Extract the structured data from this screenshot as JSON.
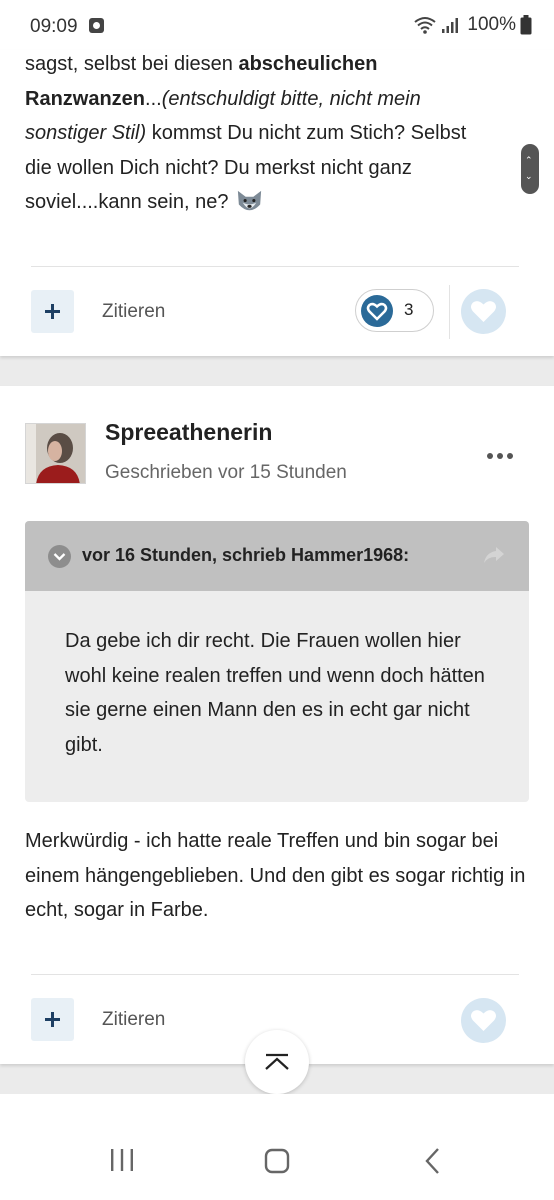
{
  "status_bar": {
    "time": "09:09",
    "battery": "100%"
  },
  "post1": {
    "text_line1_normal": "sagst, selbst bei diesen ",
    "text_line1_bold": "abscheulichen",
    "text_line2_bold": "Ranzwanzen",
    "text_line2_normal": "...",
    "text_line2_italic": "(entschuldigt bitte, nicht mein",
    "text_line3_italic": "sonstiger Stil)",
    "text_line3_normal": " kommst Du nicht zum Stich? Selbst",
    "text_line4": "die wollen Dich nicht? Du merkst nicht ganz",
    "text_line5": "soviel....kann sein, ne? ",
    "emoji": "wolf-face",
    "quote_label": "Zitieren",
    "like_count": "3"
  },
  "post2": {
    "author": "Spreeathenerin",
    "meta": "Geschrieben vor 15 Stunden",
    "quote": {
      "header": "vor 16 Stunden, schrieb Hammer1968:",
      "body": "Da gebe ich dir recht. Die Frauen wollen hier wohl keine realen treffen und wenn doch hätten sie gerne einen Mann den es in echt gar nicht gibt."
    },
    "reply": "Merkwürdig - ich hatte reale Treffen und bin sogar bei einem hängengeblieben. Und den gibt es sogar richtig in echt, sogar in Farbe.",
    "quote_label": "Zitieren"
  },
  "colors": {
    "accent": "#2b6a98",
    "plus_icon": "#1d3f63",
    "quote_header_bg": "#c0c0c0",
    "quote_body_bg": "#ededed",
    "heart_idle": "#d6e6f2"
  }
}
